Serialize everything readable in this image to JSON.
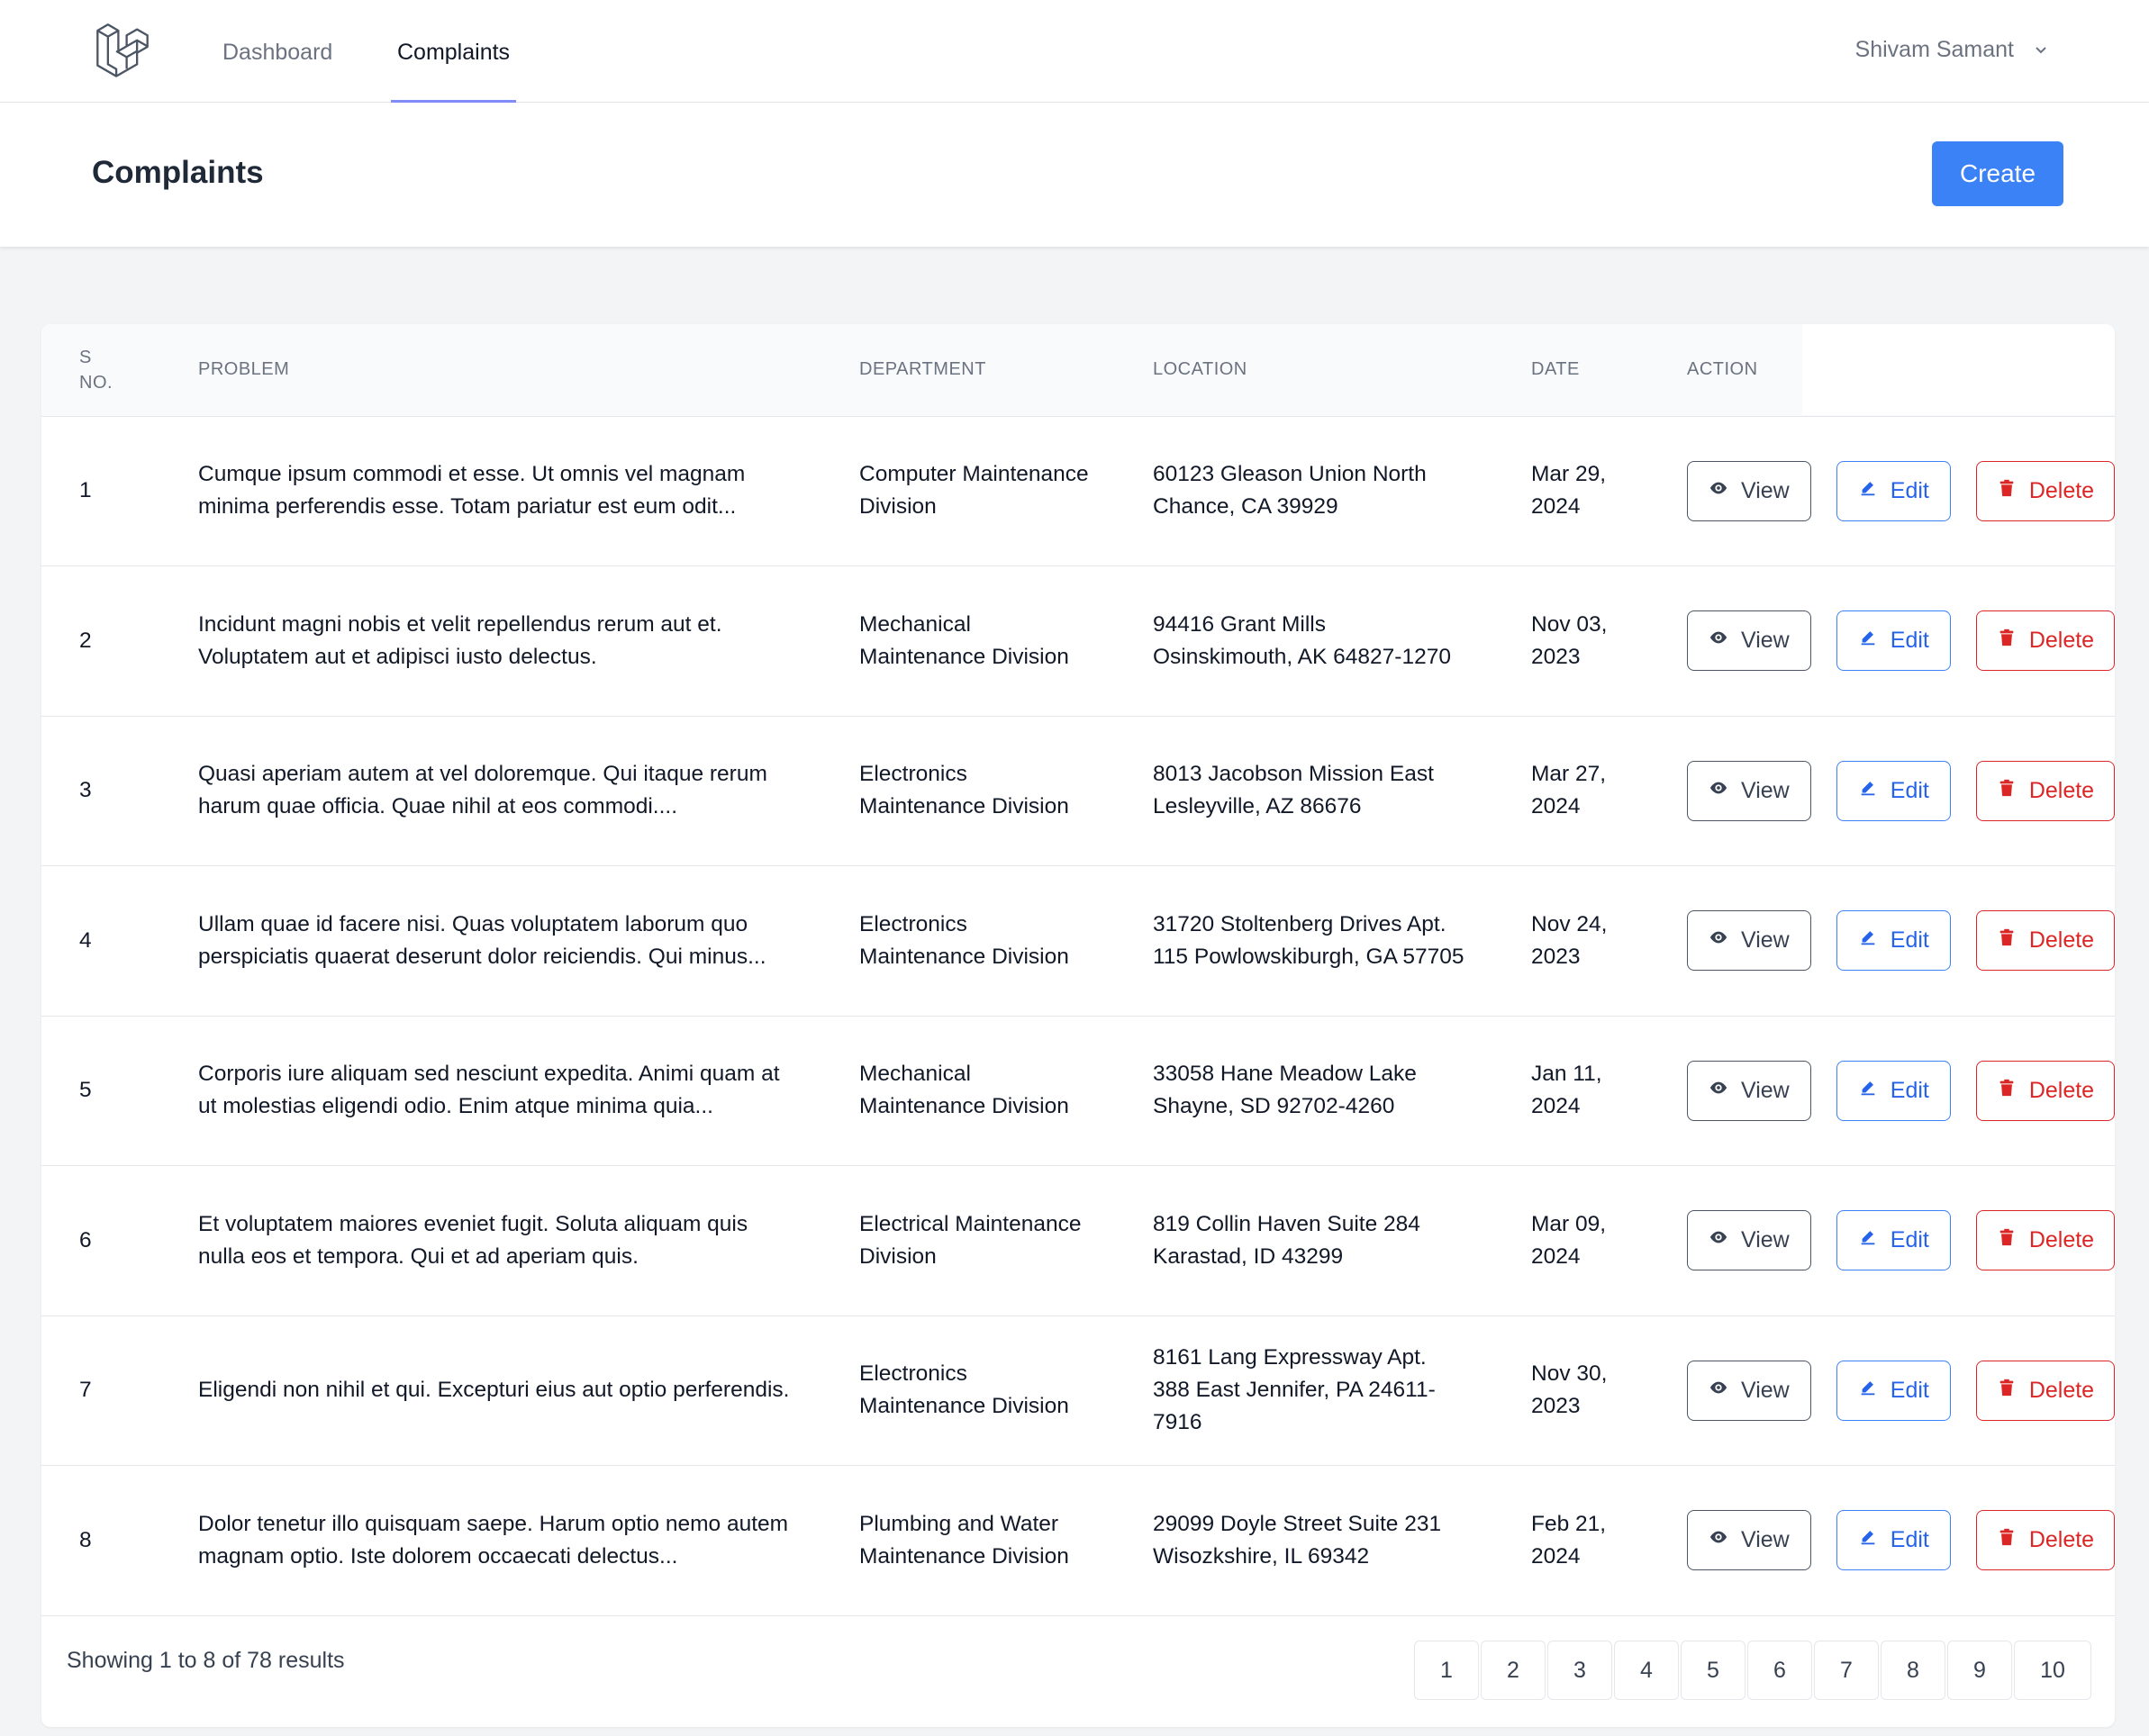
{
  "nav": {
    "links": [
      {
        "label": "Dashboard",
        "active": false
      },
      {
        "label": "Complaints",
        "active": true
      }
    ],
    "user_name": "Shivam Samant",
    "logo_icon": "laravel-logo-icon"
  },
  "header": {
    "title": "Complaints",
    "create_label": "Create",
    "accent_color": "#3b82f6"
  },
  "table": {
    "columns": {
      "sno": "S NO.",
      "problem": "PROBLEM",
      "department": "DEPARTMENT",
      "location": "LOCATION",
      "date": "DATE",
      "action": "ACTION"
    },
    "action_labels": {
      "view": "View",
      "edit": "Edit",
      "delete": "Delete"
    },
    "rows": [
      {
        "sno": "1",
        "problem": "Cumque ipsum commodi et esse. Ut omnis vel magnam minima perferendis esse. Totam pariatur est eum odit...",
        "department": "Computer Maintenance Division",
        "location": "60123 Gleason Union North Chance, CA 39929",
        "date": "Mar 29, 2024"
      },
      {
        "sno": "2",
        "problem": "Incidunt magni nobis et velit repellendus rerum aut et. Voluptatem aut et adipisci iusto delectus.",
        "department": "Mechanical Maintenance Division",
        "location": "94416 Grant Mills Osinskimouth, AK 64827-1270",
        "date": "Nov 03, 2023"
      },
      {
        "sno": "3",
        "problem": "Quasi aperiam autem at vel doloremque. Qui itaque rerum harum quae officia. Quae nihil at eos commodi....",
        "department": "Electronics Maintenance Division",
        "location": "8013 Jacobson Mission East Lesleyville, AZ 86676",
        "date": "Mar 27, 2024"
      },
      {
        "sno": "4",
        "problem": "Ullam quae id facere nisi. Quas voluptatem laborum quo perspiciatis quaerat deserunt dolor reiciendis. Qui minus...",
        "department": "Electronics Maintenance Division",
        "location": "31720 Stoltenberg Drives Apt. 115 Powlowskiburgh, GA 57705",
        "date": "Nov 24, 2023"
      },
      {
        "sno": "5",
        "problem": "Corporis iure aliquam sed nesciunt expedita. Animi quam at ut molestias eligendi odio. Enim atque minima quia...",
        "department": "Mechanical Maintenance Division",
        "location": "33058 Hane Meadow Lake Shayne, SD 92702-4260",
        "date": "Jan 11, 2024"
      },
      {
        "sno": "6",
        "problem": "Et voluptatem maiores eveniet fugit. Soluta aliquam quis nulla eos et tempora. Qui et ad aperiam quis.",
        "department": "Electrical Maintenance Division",
        "location": "819 Collin Haven Suite 284 Karastad, ID 43299",
        "date": "Mar 09, 2024"
      },
      {
        "sno": "7",
        "problem": "Eligendi non nihil et qui. Excepturi eius aut optio perferendis.",
        "department": "Electronics Maintenance Division",
        "location": "8161 Lang Expressway Apt. 388 East Jennifer, PA 24611-7916",
        "date": "Nov 30, 2023"
      },
      {
        "sno": "8",
        "problem": "Dolor tenetur illo quisquam saepe. Harum optio nemo autem magnam optio. Iste dolorem occaecati delectus...",
        "department": "Plumbing and Water Maintenance Division",
        "location": "29099 Doyle Street Suite 231 Wisozkshire, IL 69342",
        "date": "Feb 21, 2024"
      }
    ]
  },
  "footer": {
    "showing_text": "Showing 1 to 8 of 78 results",
    "pages": [
      "1",
      "2",
      "3",
      "4",
      "5",
      "6",
      "7",
      "8",
      "9",
      "10"
    ]
  }
}
